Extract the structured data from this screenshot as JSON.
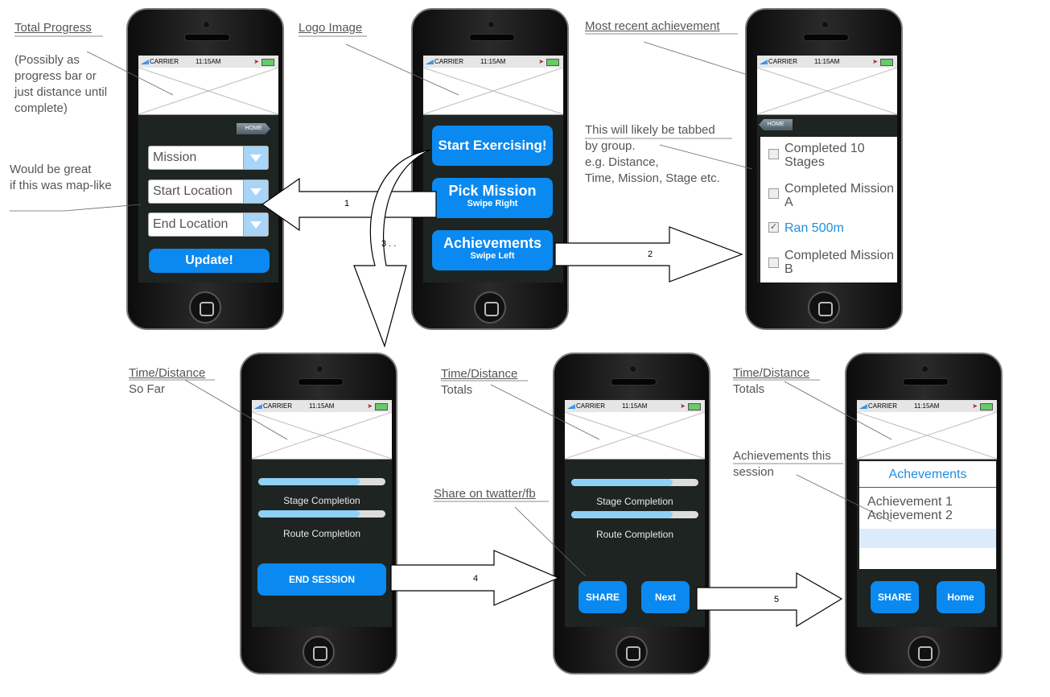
{
  "notes": {
    "total_progress": "Total Progress",
    "total_progress_sub": "(Possibly as\nprogress bar or\njust distance until\ncomplete)",
    "map_like": "Would be great\nif this was map-like",
    "logo_image": "Logo Image",
    "recent_achievement": "Most recent achievement",
    "tabbed": "This will likely be tabbed\nby group.\ne.g. Distance,\nTime, Mission, Stage etc.",
    "time_so_far_a": "Time/Distance",
    "time_so_far_b": "So Far",
    "totals_a": "Time/Distance",
    "totals_b": "Totals",
    "share_on": "Share on twatter/fb",
    "totals2_a": "Time/Distance",
    "totals2_b": "Totals",
    "ach_session": "Achievements this\nsession"
  },
  "status": {
    "carrier": "CARRIER",
    "time": "11:15AM"
  },
  "arrows": {
    "a1": "1",
    "a2": "2",
    "a3": "3 . .",
    "a4": "4",
    "a5": "5"
  },
  "screen_mission": {
    "home": "HOME",
    "dropdowns": [
      "Mission",
      "Start Location",
      "End Location"
    ],
    "update": "Update!"
  },
  "screen_main": {
    "start": "Start Exercising!",
    "pick": "Pick Mission",
    "pick_sub": "Swipe Right",
    "ach": "Achievements",
    "ach_sub": "Swipe Left"
  },
  "screen_achievements": {
    "home": "HOME",
    "items": [
      {
        "label": "Completed 10\nStages",
        "checked": false
      },
      {
        "label": "Completed Mission\nA",
        "checked": false
      },
      {
        "label": "Ran 500m",
        "checked": true
      },
      {
        "label": "Completed Mission\nB",
        "checked": false
      }
    ]
  },
  "screen_session": {
    "stage": "Stage Completion",
    "stage_progress": 0.8,
    "route": "Route Completion",
    "route_progress": 0.8,
    "end": "END SESSION"
  },
  "screen_totals": {
    "stage": "Stage Completion",
    "stage_progress": 0.8,
    "route": "Route Completion",
    "route_progress": 0.8,
    "share": "SHARE",
    "next": "Next"
  },
  "screen_final": {
    "title": "Achevements",
    "items": [
      "Achievement 1",
      "Achievement 2"
    ],
    "share": "SHARE",
    "home": "Home"
  }
}
